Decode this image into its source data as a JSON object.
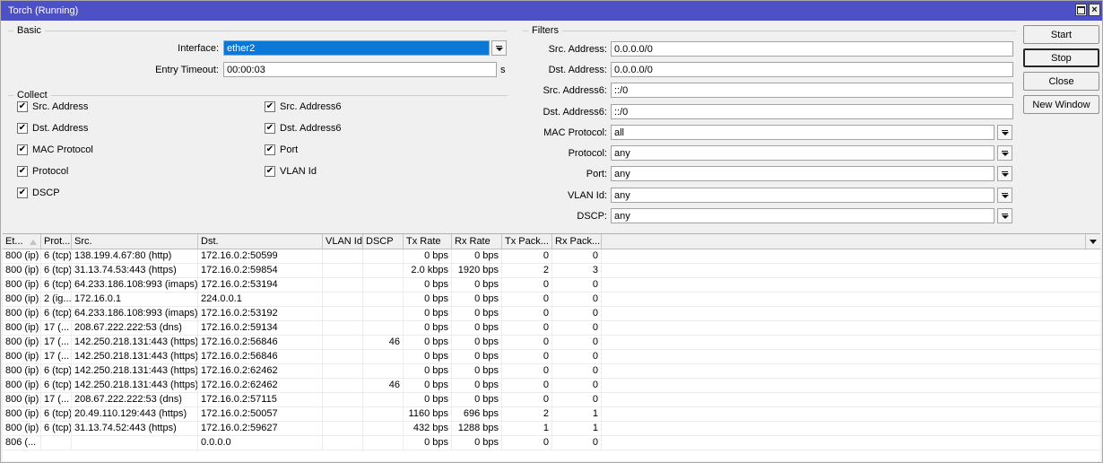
{
  "window": {
    "title": "Torch (Running)"
  },
  "titlebar_icons": {
    "close_glyph": "×",
    "restore_icon": "restore-window"
  },
  "basic": {
    "legend": "Basic",
    "interface": {
      "label": "Interface:",
      "value": "ether2",
      "selected": true
    },
    "entry_timeout": {
      "label": "Entry Timeout:",
      "value": "00:00:03",
      "suffix": "s"
    }
  },
  "collect": {
    "legend": "Collect",
    "left_column": [
      {
        "label": "Src. Address",
        "checked": true
      },
      {
        "label": "Dst. Address",
        "checked": true
      },
      {
        "label": "MAC Protocol",
        "checked": true
      },
      {
        "label": "Protocol",
        "checked": true
      },
      {
        "label": "DSCP",
        "checked": true
      }
    ],
    "right_column": [
      {
        "label": "Src. Address6",
        "checked": true
      },
      {
        "label": "Dst. Address6",
        "checked": true
      },
      {
        "label": "Port",
        "checked": true
      },
      {
        "label": "VLAN Id",
        "checked": true
      }
    ]
  },
  "filters": {
    "legend": "Filters",
    "fields": [
      {
        "label": "Src. Address:",
        "value": "0.0.0.0/0",
        "combo": false
      },
      {
        "label": "Dst. Address:",
        "value": "0.0.0.0/0",
        "combo": false
      },
      {
        "label": "Src. Address6:",
        "value": "::/0",
        "combo": false
      },
      {
        "label": "Dst. Address6:",
        "value": "::/0",
        "combo": false
      },
      {
        "label": "MAC Protocol:",
        "value": "all",
        "combo": true
      },
      {
        "label": "Protocol:",
        "value": "any",
        "combo": true
      },
      {
        "label": "Port:",
        "value": "any",
        "combo": true
      },
      {
        "label": "VLAN Id:",
        "value": "any",
        "combo": true
      },
      {
        "label": "DSCP:",
        "value": "any",
        "combo": true
      }
    ]
  },
  "actions": [
    {
      "label": "Start",
      "default": false
    },
    {
      "label": "Stop",
      "default": true
    },
    {
      "label": "Close",
      "default": false
    },
    {
      "label": "New Window",
      "default": false
    }
  ],
  "table": {
    "columns": [
      {
        "label": "Et...",
        "sorted_asc": true
      },
      {
        "label": "Prot..."
      },
      {
        "label": "Src."
      },
      {
        "label": "Dst."
      },
      {
        "label": "VLAN Id"
      },
      {
        "label": "DSCP"
      },
      {
        "label": "Tx Rate"
      },
      {
        "label": "Rx Rate"
      },
      {
        "label": "Tx Pack..."
      },
      {
        "label": "Rx Pack..."
      }
    ],
    "rows": [
      [
        "800 (ip)",
        "6 (tcp)",
        "138.199.4.67:80 (http)",
        "172.16.0.2:50599",
        "",
        "",
        "0 bps",
        "0 bps",
        "0",
        "0"
      ],
      [
        "800 (ip)",
        "6 (tcp)",
        "31.13.74.53:443 (https)",
        "172.16.0.2:59854",
        "",
        "",
        "2.0 kbps",
        "1920 bps",
        "2",
        "3"
      ],
      [
        "800 (ip)",
        "6 (tcp)",
        "64.233.186.108:993 (imaps)",
        "172.16.0.2:53194",
        "",
        "",
        "0 bps",
        "0 bps",
        "0",
        "0"
      ],
      [
        "800 (ip)",
        "2 (ig...",
        "172.16.0.1",
        "224.0.0.1",
        "",
        "",
        "0 bps",
        "0 bps",
        "0",
        "0"
      ],
      [
        "800 (ip)",
        "6 (tcp)",
        "64.233.186.108:993 (imaps)",
        "172.16.0.2:53192",
        "",
        "",
        "0 bps",
        "0 bps",
        "0",
        "0"
      ],
      [
        "800 (ip)",
        "17 (...",
        "208.67.222.222:53 (dns)",
        "172.16.0.2:59134",
        "",
        "",
        "0 bps",
        "0 bps",
        "0",
        "0"
      ],
      [
        "800 (ip)",
        "17 (...",
        "142.250.218.131:443 (https)",
        "172.16.0.2:56846",
        "",
        "46",
        "0 bps",
        "0 bps",
        "0",
        "0"
      ],
      [
        "800 (ip)",
        "17 (...",
        "142.250.218.131:443 (https)",
        "172.16.0.2:56846",
        "",
        "",
        "0 bps",
        "0 bps",
        "0",
        "0"
      ],
      [
        "800 (ip)",
        "6 (tcp)",
        "142.250.218.131:443 (https)",
        "172.16.0.2:62462",
        "",
        "",
        "0 bps",
        "0 bps",
        "0",
        "0"
      ],
      [
        "800 (ip)",
        "6 (tcp)",
        "142.250.218.131:443 (https)",
        "172.16.0.2:62462",
        "",
        "46",
        "0 bps",
        "0 bps",
        "0",
        "0"
      ],
      [
        "800 (ip)",
        "17 (...",
        "208.67.222.222:53 (dns)",
        "172.16.0.2:57115",
        "",
        "",
        "0 bps",
        "0 bps",
        "0",
        "0"
      ],
      [
        "800 (ip)",
        "6 (tcp)",
        "20.49.110.129:443 (https)",
        "172.16.0.2:50057",
        "",
        "",
        "1160 bps",
        "696 bps",
        "2",
        "1"
      ],
      [
        "800 (ip)",
        "6 (tcp)",
        "31.13.74.52:443 (https)",
        "172.16.0.2:59627",
        "",
        "",
        "432 bps",
        "1288 bps",
        "1",
        "1"
      ],
      [
        "806 (...",
        "",
        "",
        "0.0.0.0",
        "",
        "",
        "0 bps",
        "0 bps",
        "0",
        "0"
      ]
    ]
  }
}
